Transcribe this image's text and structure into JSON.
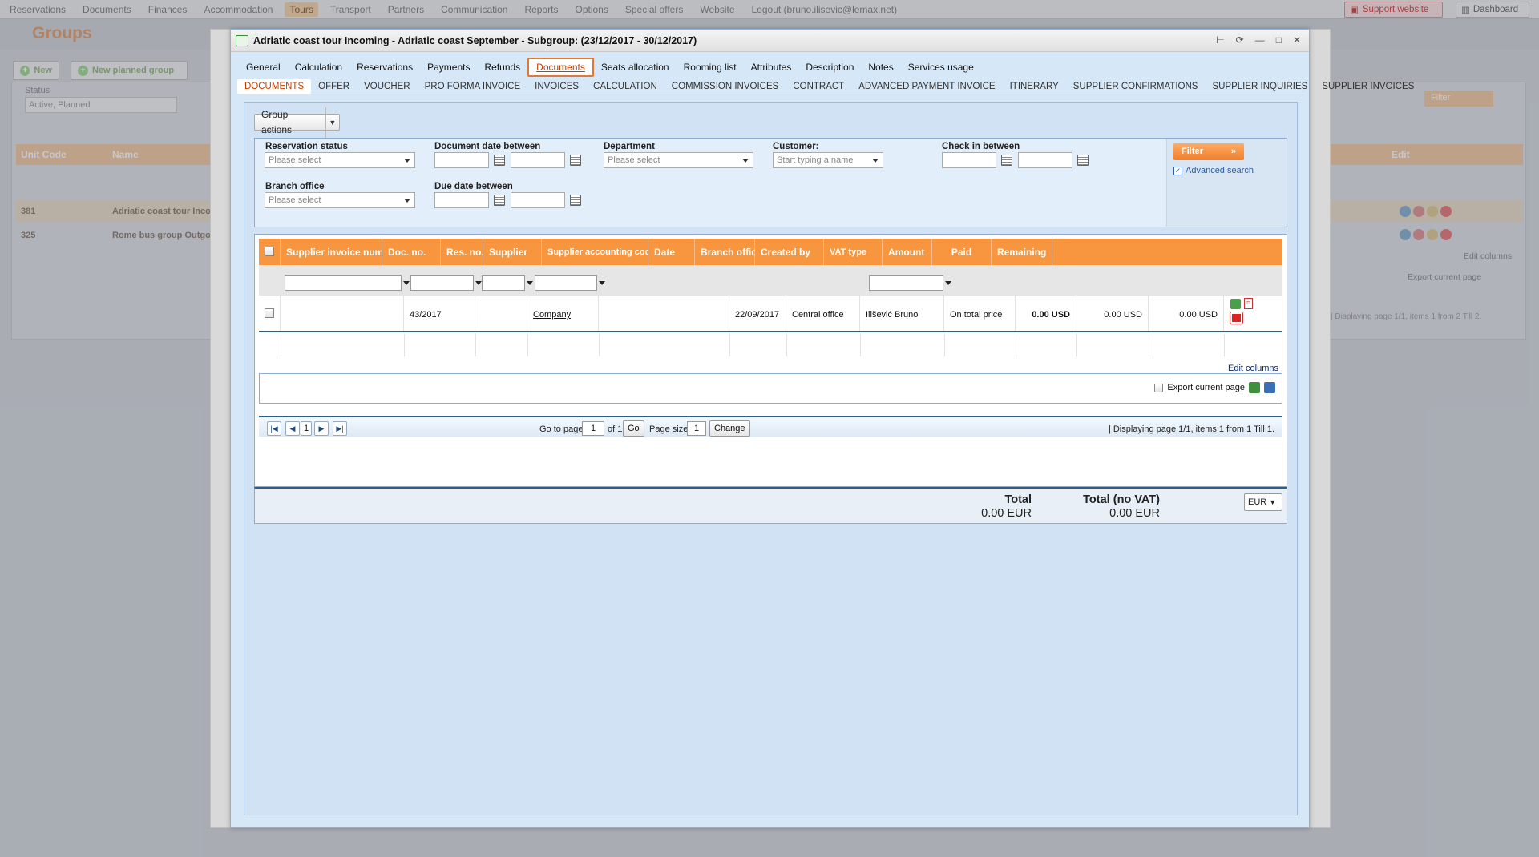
{
  "topnav": {
    "items": [
      "Reservations",
      "Documents",
      "Finances",
      "Accommodation",
      "Tours",
      "Transport",
      "Partners",
      "Communication",
      "Reports",
      "Options",
      "Special offers",
      "Website",
      "Logout (bruno.ilisevic@lemax.net)"
    ],
    "active": "Tours",
    "support": "Support website",
    "dashboard": "Dashboard"
  },
  "background": {
    "title": "Groups",
    "buttons": [
      "New",
      "New planned group"
    ],
    "status_label": "Status",
    "status_value": "Active, Planned",
    "filter_label": "Filter",
    "table_headers": [
      "Unit Code",
      "Name",
      "Edit"
    ],
    "rows": [
      {
        "code": "381",
        "name": "Adriatic coast tour Inco"
      },
      {
        "code": "325",
        "name": "Rome bus group Outgo"
      }
    ],
    "edit_columns": "Edit columns",
    "export": "Export current page",
    "pager_text": "| Displaying page  1/1,  items  1  from  2  Till  2."
  },
  "dialog": {
    "title": "Adriatic coast tour Incoming - Adriatic coast September - Subgroup: (23/12/2017 - 30/12/2017)",
    "tabs": [
      "General",
      "Calculation",
      "Reservations",
      "Payments",
      "Refunds",
      "Documents",
      "Seats allocation",
      "Rooming list",
      "Attributes",
      "Description",
      "Notes",
      "Services usage"
    ],
    "active_tab": "Documents",
    "subtabs": [
      "DOCUMENTS",
      "OFFER",
      "VOUCHER",
      "PRO FORMA INVOICE",
      "INVOICES",
      "CALCULATION",
      "COMMISSION INVOICES",
      "CONTRACT",
      "ADVANCED PAYMENT INVOICE",
      "ITINERARY",
      "SUPPLIER CONFIRMATIONS",
      "SUPPLIER INQUIRIES",
      "SUPPLIER INVOICES"
    ],
    "active_subtab": "DOCUMENTS"
  },
  "toolbar": {
    "group_actions": "Group actions"
  },
  "filters": {
    "reservation_status": {
      "label": "Reservation status",
      "placeholder": "Please select"
    },
    "document_date": {
      "label": "Document date between"
    },
    "department": {
      "label": "Department",
      "placeholder": "Please select"
    },
    "customer": {
      "label": "Customer:",
      "placeholder": "Start typing a name"
    },
    "check_in": {
      "label": "Check in between"
    },
    "branch_office": {
      "label": "Branch office",
      "placeholder": "Please select"
    },
    "due_date": {
      "label": "Due date between"
    },
    "filter_button": "Filter",
    "advanced_search": "Advanced search"
  },
  "grid": {
    "columns": [
      "Supplier invoice number",
      "Doc. no.",
      "Res. no.",
      "Supplier",
      "Supplier accounting code",
      "Date",
      "Branch office",
      "Created by",
      "VAT type",
      "Amount",
      "Paid",
      "Remaining"
    ],
    "rows": [
      {
        "supplier_invoice_number": "",
        "doc_no": "43/2017",
        "res_no": "",
        "supplier": "Company",
        "accounting_code": "",
        "date": "22/09/2017",
        "branch_office": "Central office",
        "created_by": "Ilišević Bruno",
        "vat_type": "On total price",
        "amount": "0.00 USD",
        "paid": "0.00 USD",
        "remaining": "0.00 USD"
      }
    ],
    "edit_columns": "Edit columns",
    "export_label": "Export current page"
  },
  "pager": {
    "go_to_page_label": "Go to page:",
    "page": "1",
    "of_label": "of 1",
    "go": "Go",
    "page_size_label": "Page size:",
    "page_size": "1",
    "change": "Change",
    "current_page_btn": "1",
    "summary": "| Displaying page  1/1,  items  1  from  1  Till  1."
  },
  "totals": {
    "total_label": "Total",
    "total_value": "0.00 EUR",
    "total_no_vat_label": "Total (no VAT)",
    "total_no_vat_value": "0.00 EUR",
    "currency": "EUR"
  },
  "colors": {
    "accent": "#f7963f",
    "active_tab": "#e0783a",
    "panel": "#d0e2f4"
  }
}
